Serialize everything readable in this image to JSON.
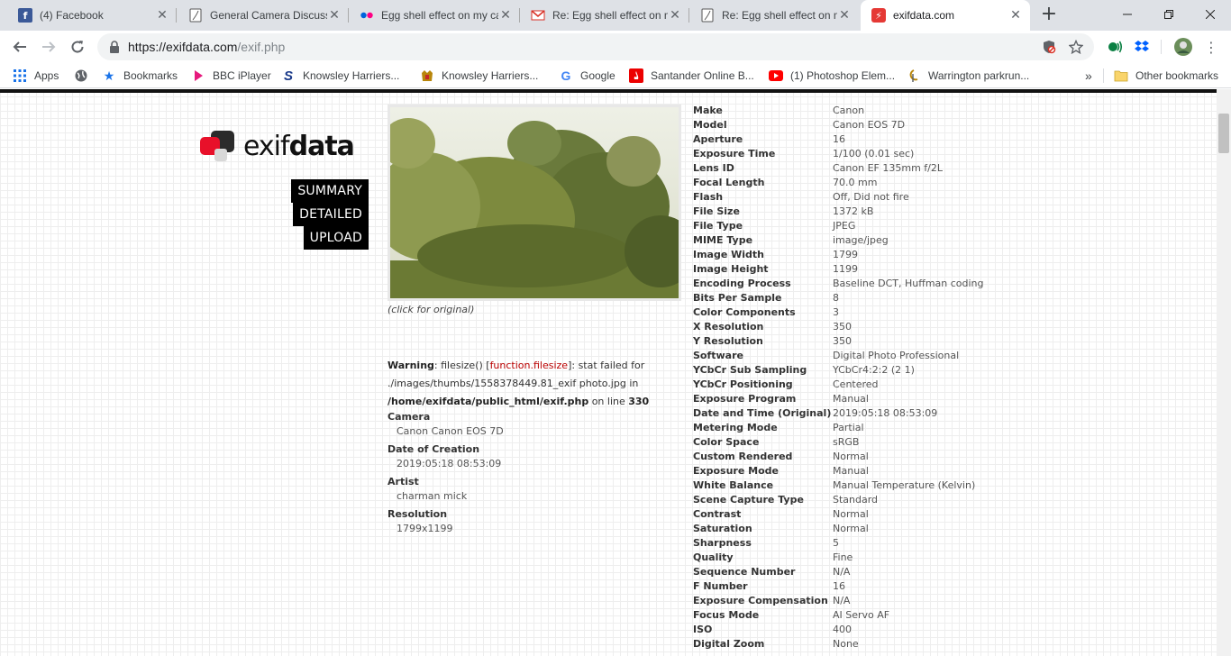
{
  "browser": {
    "tabs": [
      {
        "title": "(4) Facebook",
        "icon": "facebook-icon",
        "color": "#3b5998"
      },
      {
        "title": "General Camera Discussion",
        "icon": "page-icon",
        "color": "#ffffff"
      },
      {
        "title": "Egg shell effect on my camera",
        "icon": "flickr-icon",
        "color": "#0063dc"
      },
      {
        "title": "Re: Egg shell effect on my camera",
        "icon": "gmail-icon",
        "color": "#d93025"
      },
      {
        "title": "Re: Egg shell effect on my camera",
        "icon": "page-icon",
        "color": "#ffffff"
      },
      {
        "title": "exifdata.com",
        "icon": "exifdata-icon",
        "color": "#e53935"
      }
    ],
    "new_tab": "+",
    "url_host": "https://exifdata.com",
    "url_path": "/exif.php"
  },
  "bookmarks": [
    {
      "label": "Apps",
      "icon": "apps-grid-icon"
    },
    {
      "label": "",
      "icon": "globe-icon"
    },
    {
      "label": "Bookmarks",
      "icon": "star-icon"
    },
    {
      "label": "BBC iPlayer",
      "icon": "iplayer-icon"
    },
    {
      "label": "Knowsley Harriers...",
      "icon": "knowsley-s-icon"
    },
    {
      "label": "Knowsley Harriers...",
      "icon": "crest-icon"
    },
    {
      "label": "Google",
      "icon": "google-icon"
    },
    {
      "label": "Santander Online B...",
      "icon": "santander-icon"
    },
    {
      "label": "(1) Photoshop Elem...",
      "icon": "youtube-icon"
    },
    {
      "label": "Warrington parkrun...",
      "icon": "parkrun-icon"
    }
  ],
  "bookmarks_more": "»",
  "other_bookmarks": "Other bookmarks",
  "site": {
    "logo_light": "exif",
    "logo_bold": "data",
    "menu": [
      "SUMMARY",
      "DETAILED",
      "UPLOAD"
    ],
    "caption": "(click for original)",
    "warning": {
      "label": "Warning",
      "text1": ": filesize() [",
      "func": "function.filesize",
      "text2": "]: stat failed for ./images/thumbs/1558378449.81_exif photo.jpg in ",
      "path": "/home/exifdata/public_html/exif.php",
      "text3": " on line ",
      "line": "330"
    },
    "summary": [
      {
        "label": "Camera",
        "value": "Canon Canon EOS 7D"
      },
      {
        "label": "Date of Creation",
        "value": "2019:05:18 08:53:09"
      },
      {
        "label": "Artist",
        "value": "charman mick"
      },
      {
        "label": "Resolution",
        "value": "1799x1199"
      }
    ]
  },
  "exif": [
    {
      "k": "Make",
      "v": "Canon"
    },
    {
      "k": "Model",
      "v": "Canon EOS 7D"
    },
    {
      "k": "Aperture",
      "v": "16"
    },
    {
      "k": "Exposure Time",
      "v": "1/100 (0.01 sec)"
    },
    {
      "k": "Lens ID",
      "v": "Canon EF 135mm f/2L"
    },
    {
      "k": "Focal Length",
      "v": "70.0 mm"
    },
    {
      "k": "Flash",
      "v": "Off, Did not fire"
    },
    {
      "k": "File Size",
      "v": "1372 kB"
    },
    {
      "k": "File Type",
      "v": "JPEG"
    },
    {
      "k": "MIME Type",
      "v": "image/jpeg"
    },
    {
      "k": "Image Width",
      "v": "1799"
    },
    {
      "k": "Image Height",
      "v": "1199"
    },
    {
      "k": "Encoding Process",
      "v": "Baseline DCT, Huffman coding"
    },
    {
      "k": "Bits Per Sample",
      "v": "8"
    },
    {
      "k": "Color Components",
      "v": "3"
    },
    {
      "k": "X Resolution",
      "v": "350"
    },
    {
      "k": "Y Resolution",
      "v": "350"
    },
    {
      "k": "Software",
      "v": "Digital Photo Professional"
    },
    {
      "k": "YCbCr Sub Sampling",
      "v": "YCbCr4:2:2 (2 1)"
    },
    {
      "k": "YCbCr Positioning",
      "v": "Centered"
    },
    {
      "k": "Exposure Program",
      "v": "Manual"
    },
    {
      "k": "Date and Time (Original)",
      "v": "2019:05:18 08:53:09"
    },
    {
      "k": "Metering Mode",
      "v": "Partial"
    },
    {
      "k": "Color Space",
      "v": "sRGB"
    },
    {
      "k": "Custom Rendered",
      "v": "Normal"
    },
    {
      "k": "Exposure Mode",
      "v": "Manual"
    },
    {
      "k": "White Balance",
      "v": "Manual Temperature (Kelvin)"
    },
    {
      "k": "Scene Capture Type",
      "v": "Standard"
    },
    {
      "k": "Contrast",
      "v": "Normal"
    },
    {
      "k": "Saturation",
      "v": "Normal"
    },
    {
      "k": "Sharpness",
      "v": "5"
    },
    {
      "k": "Quality",
      "v": "Fine"
    },
    {
      "k": "Sequence Number",
      "v": "N/A"
    },
    {
      "k": "F Number",
      "v": "16"
    },
    {
      "k": "Exposure Compensation",
      "v": "N/A"
    },
    {
      "k": "Focus Mode",
      "v": "AI Servo AF"
    },
    {
      "k": "ISO",
      "v": "400"
    },
    {
      "k": "Digital Zoom",
      "v": "None"
    }
  ]
}
